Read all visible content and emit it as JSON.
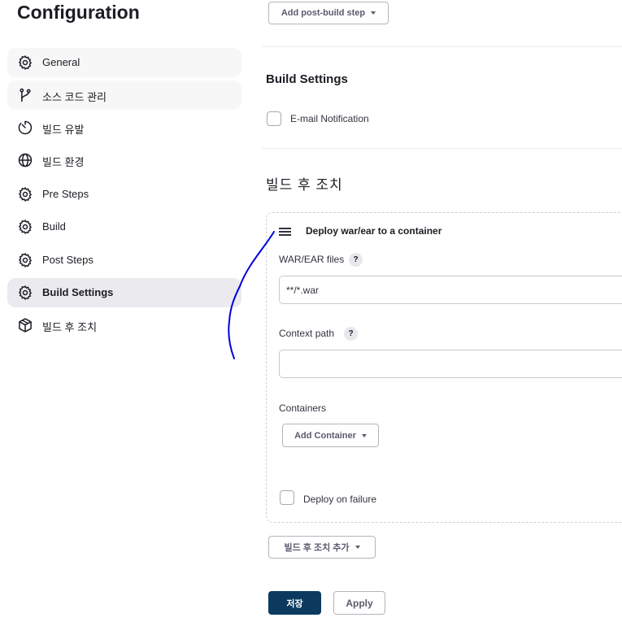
{
  "page": {
    "title": "Configuration"
  },
  "sidebar": {
    "items": [
      {
        "label": "General",
        "icon": "gear-icon"
      },
      {
        "label": "소스 코드 관리",
        "icon": "branch-icon"
      },
      {
        "label": "빌드 유발",
        "icon": "timer-icon"
      },
      {
        "label": "빌드 환경",
        "icon": "globe-icon"
      },
      {
        "label": "Pre Steps",
        "icon": "gear-icon"
      },
      {
        "label": "Build",
        "icon": "gear-icon"
      },
      {
        "label": "Post Steps",
        "icon": "gear-icon"
      },
      {
        "label": "Build Settings",
        "icon": "gear-icon",
        "active": true
      },
      {
        "label": "빌드 후 조치",
        "icon": "package-icon"
      }
    ]
  },
  "main": {
    "add_post_build_step": "Add post-build step",
    "build_settings": {
      "title": "Build Settings",
      "email_notification": "E-mail Notification",
      "email_checked": false
    },
    "post_build": {
      "title": "빌드 후 조치",
      "deploy": {
        "title": "Deploy war/ear to a container",
        "war_label": "WAR/EAR files",
        "war_value": "**/*.war",
        "context_label": "Context path",
        "context_value": "",
        "help": "?",
        "containers_label": "Containers",
        "add_container": "Add Container",
        "deploy_on_failure": "Deploy on failure",
        "deploy_on_failure_checked": false
      },
      "add_action": "빌드 후 조치 추가"
    },
    "save": "저장",
    "apply": "Apply"
  },
  "colors": {
    "primary": "#0b3a5e",
    "active_nav": "#ebebef",
    "annotation": "#0000e0"
  }
}
